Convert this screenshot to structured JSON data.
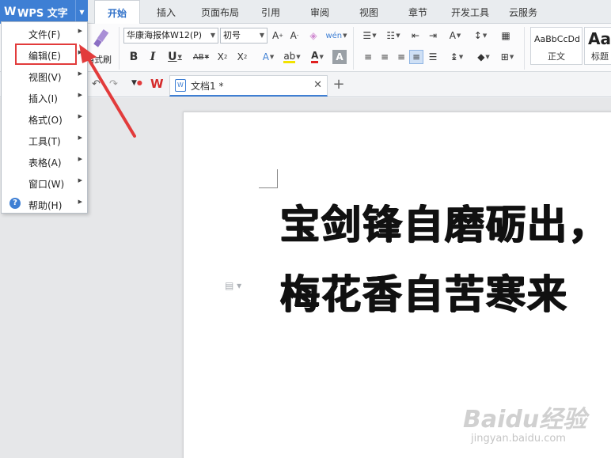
{
  "app": {
    "title": "WPS 文字",
    "logo": "W"
  },
  "tabs": [
    {
      "label": "开始"
    },
    {
      "label": "插入"
    },
    {
      "label": "页面布局"
    },
    {
      "label": "引用"
    },
    {
      "label": "审阅"
    },
    {
      "label": "视图"
    },
    {
      "label": "章节"
    },
    {
      "label": "开发工具"
    },
    {
      "label": "云服务"
    }
  ],
  "ribbon": {
    "format_painter_label": "格式刷",
    "font_name": "华康海报体W12(P)",
    "font_size": "初号",
    "styles": [
      {
        "sample": "AaBbCcDd",
        "name": "正文"
      },
      {
        "sample": "Aa",
        "name": "标题"
      }
    ]
  },
  "doc_tab": {
    "name": "文档1 *"
  },
  "document": {
    "lines": [
      "宝剑锋自磨砺出，",
      "梅花香自苦寒来"
    ]
  },
  "menu": {
    "items": [
      {
        "label": "文件(F)"
      },
      {
        "label": "编辑(E)"
      },
      {
        "label": "视图(V)"
      },
      {
        "label": "插入(I)"
      },
      {
        "label": "格式(O)"
      },
      {
        "label": "工具(T)"
      },
      {
        "label": "表格(A)"
      },
      {
        "label": "窗口(W)"
      },
      {
        "label": "帮助(H)"
      }
    ]
  },
  "watermark": {
    "line1": "Baidu经验",
    "line2": "jingyan.baidu.com"
  },
  "colors": {
    "accent": "#3e7fd4",
    "highlight": "#e23b3b"
  }
}
